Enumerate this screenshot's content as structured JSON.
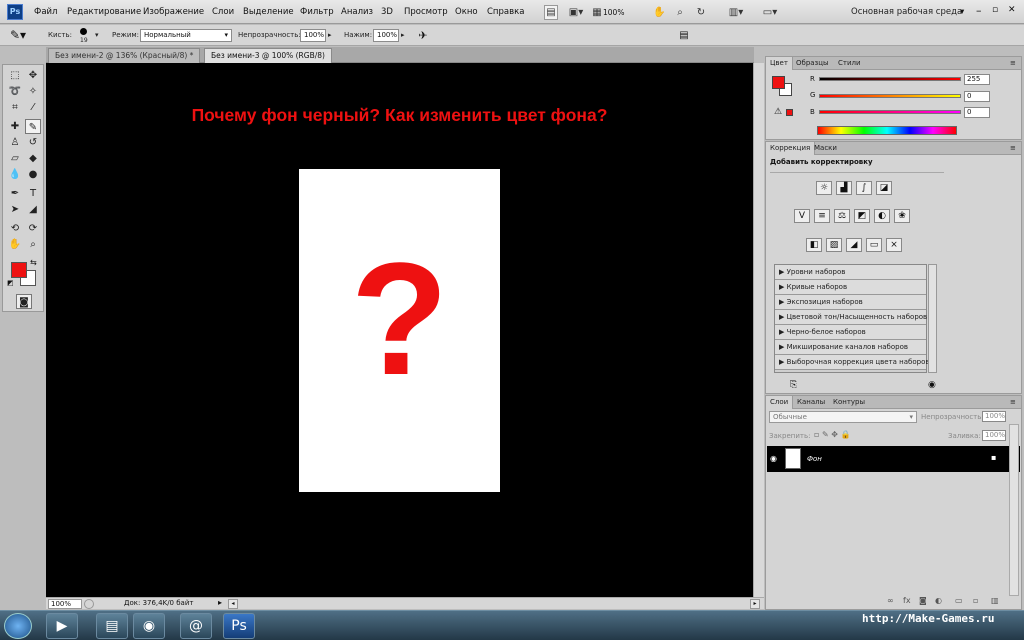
{
  "app": {
    "logo": "Ps",
    "workspace": "Основная рабочая среда"
  },
  "menu": [
    "Файл",
    "Редактирование",
    "Изображение",
    "Слои",
    "Выделение",
    "Фильтр",
    "Анализ",
    "3D",
    "Просмотр",
    "Окно",
    "Справка"
  ],
  "toolbar": {
    "zoom": "100%"
  },
  "options": {
    "brush_label": "Кисть:",
    "brush_size": "19",
    "mode_label": "Режим:",
    "mode_value": "Нормальный",
    "opacity_label": "Непрозрачность:",
    "opacity_value": "100%",
    "flow_label": "Нажим:",
    "flow_value": "100%"
  },
  "doc_tabs": [
    {
      "label": "Без имени-2 @ 136% (Красный/8) *"
    },
    {
      "label": "Без имени-3 @ 100% (RGB/8)"
    }
  ],
  "canvas": {
    "headline": "Почему фон черный? Как изменить цвет фона?",
    "symbol": "?"
  },
  "status": {
    "zoom": "100%",
    "doc_info": "Док: 376,4K/0 байт"
  },
  "color_panel": {
    "tabs": [
      "Цвет",
      "Образцы",
      "Стили"
    ],
    "channels": [
      {
        "name": "R",
        "value": "255"
      },
      {
        "name": "G",
        "value": "0"
      },
      {
        "name": "B",
        "value": "0"
      }
    ],
    "fg_color": "#ee1111"
  },
  "adjust_panel": {
    "tabs": [
      "Коррекция",
      "Маски"
    ],
    "title": "Добавить корректировку",
    "presets": [
      "Уровни наборов",
      "Кривые наборов",
      "Экспозиция наборов",
      "Цветовой тон/Насыщенность наборов",
      "Черно-белое наборов",
      "Микширование каналов наборов",
      "Выборочная коррекция цвета наборов"
    ]
  },
  "layers_panel": {
    "tabs": [
      "Слои",
      "Каналы",
      "Контуры"
    ],
    "blend_mode": "Обычные",
    "opacity_label": "Непрозрачность:",
    "opacity_value": "100%",
    "lock_label": "Закрепить:",
    "fill_label": "Заливка:",
    "fill_value": "100%",
    "layers": [
      {
        "name": "Фон"
      }
    ]
  },
  "taskbar": {
    "watermark": "http://Make-Games.ru"
  }
}
